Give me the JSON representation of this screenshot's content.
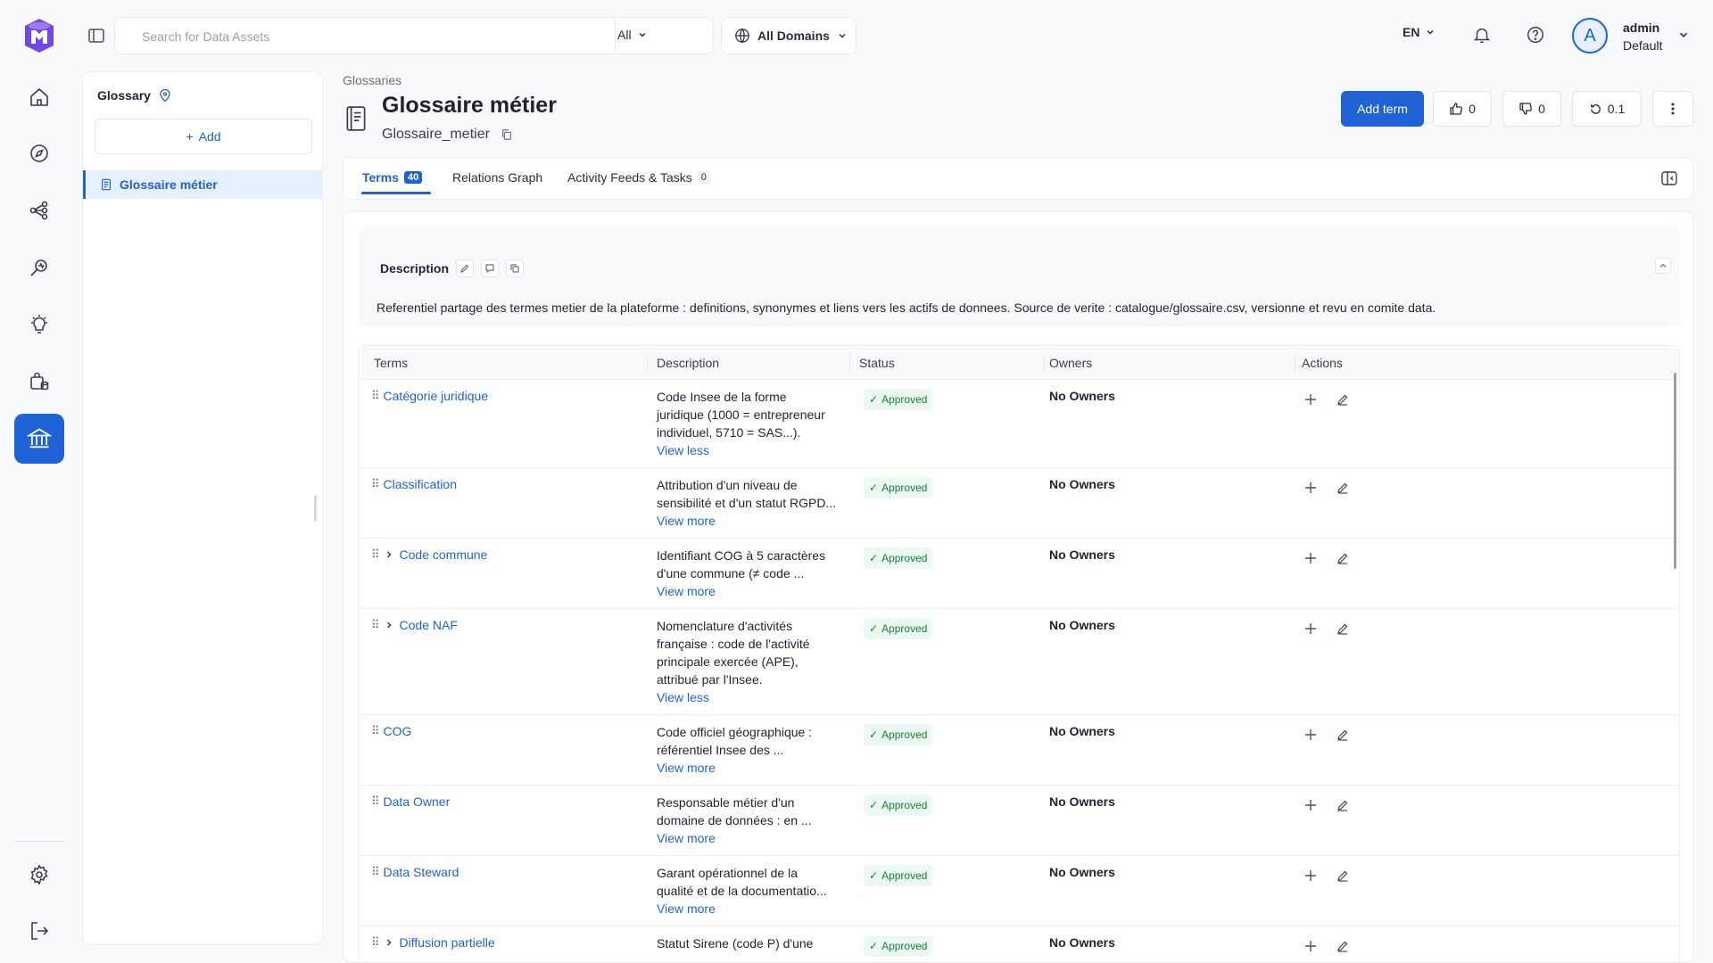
{
  "search": {
    "placeholder": "Search for Data Assets",
    "filter": "All"
  },
  "domains": {
    "label": "All Domains"
  },
  "header": {
    "language": "EN",
    "user_name": "admin",
    "user_role": "Default",
    "avatar_letter": "A"
  },
  "sidebar": {
    "items": [
      "home-icon",
      "explore-icon",
      "lineage-icon",
      "observability-icon",
      "insights-icon",
      "data-products-icon",
      "governance-icon",
      "settings-icon",
      "logout-icon"
    ]
  },
  "glossary_panel": {
    "title": "Glossary",
    "add_label": "Add",
    "selected_item": "Glossaire métier"
  },
  "page": {
    "breadcrumb": "Glossaries",
    "title": "Glossaire métier",
    "fqn": "Glossaire_metier",
    "add_term_label": "Add term",
    "likes": "0",
    "dislikes": "0",
    "version": "0.1"
  },
  "tabs": [
    {
      "label": "Terms",
      "count": "40"
    },
    {
      "label": "Relations Graph"
    },
    {
      "label": "Activity Feeds & Tasks",
      "count": "0"
    }
  ],
  "description": {
    "label": "Description",
    "text": "Referentiel partage des termes metier de la plateforme : definitions, synonymes et liens vers les actifs de donnees. Source de verite : catalogue/glossaire.csv, versionne et revu en comite data."
  },
  "table": {
    "columns": [
      "Terms",
      "Description",
      "Status",
      "Owners",
      "Actions"
    ],
    "rows": [
      {
        "term": "Catégorie juridique",
        "desc_lines": [
          "Code Insee de la forme",
          "juridique (1000 = entrepreneur",
          "individuel, 5710 = SAS...)."
        ],
        "link": "View less",
        "status": "Approved",
        "owners": "No Owners"
      },
      {
        "term": "Classification",
        "desc_lines": [
          "Attribution d'un niveau de",
          "sensibilité et d'un statut RGPD..."
        ],
        "link": "View more",
        "status": "Approved",
        "owners": "No Owners"
      },
      {
        "term": "Code commune",
        "desc_lines": [
          "Identifiant COG à 5 caractères",
          "d'une commune (≠ code ..."
        ],
        "link": "View more",
        "status": "Approved",
        "owners": "No Owners"
      },
      {
        "term": "Code NAF",
        "desc_lines": [
          "Nomenclature d'activités",
          "française : code de l'activité",
          "principale exercée (APE),",
          "attribué par l'Insee."
        ],
        "link": "View less",
        "status": "Approved",
        "owners": "No Owners"
      },
      {
        "term": "COG",
        "desc_lines": [
          "Code officiel géographique :",
          "référentiel Insee des ..."
        ],
        "link": "View more",
        "status": "Approved",
        "owners": "No Owners"
      },
      {
        "term": "Data Owner",
        "desc_lines": [
          "Responsable métier d'un",
          "domaine de données : en ..."
        ],
        "link": "View more",
        "status": "Approved",
        "owners": "No Owners"
      },
      {
        "term": "Data Steward",
        "desc_lines": [
          "Garant opérationnel de la",
          "qualité et de la documentatio..."
        ],
        "link": "View more",
        "status": "Approved",
        "owners": "No Owners"
      },
      {
        "term": "Diffusion partielle",
        "desc_lines": [
          "Statut Sirene (code P) d'une"
        ],
        "link": "",
        "status": "Approved",
        "owners": "No Owners"
      }
    ]
  },
  "colors": {
    "accent": "#1f62d6",
    "approved_bg": "#ecf9f1",
    "approved_text": "#15803d"
  }
}
